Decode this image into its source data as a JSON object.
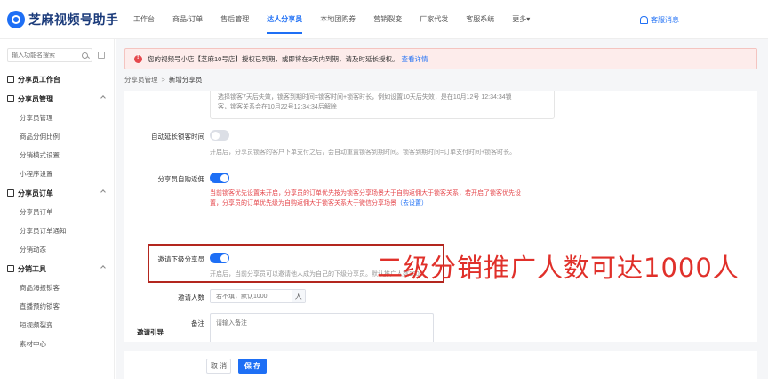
{
  "app": {
    "title": "芝麻视频号助手"
  },
  "nav": {
    "items": [
      "工作台",
      "商品/订单",
      "售后管理",
      "达人分享员",
      "本地团购券",
      "营销裂变",
      "厂家代发",
      "客服系统",
      "更多▾"
    ],
    "active_index": 3,
    "service": "客服消息"
  },
  "sidebar": {
    "search_placeholder": "输入功能名搜索",
    "workbench": "分享员工作台",
    "groups": [
      {
        "title": "分享员管理",
        "items": [
          "分享员管理",
          "商品分佣比例",
          "分销模式设置",
          "小程序设置"
        ]
      },
      {
        "title": "分享员订单",
        "items": [
          "分享员订单",
          "分享员订单通知",
          "分销动态"
        ]
      },
      {
        "title": "分销工具",
        "items": [
          "商品海报锁客",
          "直播预约锁客",
          "短视频裂变",
          "素材中心"
        ]
      }
    ]
  },
  "alert": {
    "text": "您的视频号小店【芝麻10号店】授权已到期，或即将在3天内到期，请及时延长授权。",
    "link": "查看详情"
  },
  "breadcrumb": {
    "parent": "分享员管理",
    "separator": ">",
    "current": "新增分享员"
  },
  "form": {
    "note_line1": "选择锁客7天后失效，锁客到期时间=锁客时间+锁客时长，例如设置10天后失效，是在10月12号 12:34:34锁",
    "note_line2": "客，锁客关系会在10月22号12:34:34后解除",
    "auto_extend": {
      "label": "自动延长锁客时间",
      "on": false,
      "help": "开启后，分享员锁客的客户下单支付之后，会自动重置锁客到期时间。锁客到期时间=订单支付时间+锁客时长。"
    },
    "self_buy": {
      "label": "分享员自购返佣",
      "on": true,
      "help_line1": "当前锁客优先设置未开启，分享员的订单优先按为锁客分享场景大于自购返佣大于锁客关系，若开启了锁客优先设",
      "help_line2": "置，分享员的订单优先级为自购返佣大于锁客关系大于微信分享场景",
      "help_link": "（去设置）"
    },
    "invite": {
      "label": "邀请下级分享员",
      "on": true,
      "help": "开启后，当前分享员可以邀请他人成为自己的下级分享员。默认推广人数1000"
    },
    "invite_count": {
      "label": "邀请人数",
      "placeholder": "若不填，默认1000",
      "suffix": "人"
    },
    "remark": {
      "label": "备注",
      "placeholder": "请输入备注"
    },
    "section_title": "邀请引导"
  },
  "overlay": {
    "text": "二级分销推广人数可达1000人"
  },
  "footer": {
    "cancel": "取 消",
    "save": "保 存"
  },
  "colors": {
    "accent": "#1e6ff5",
    "alert_bg": "#fdeceb",
    "overlay_red": "#e0302a",
    "highlight_border": "#b3261e"
  }
}
